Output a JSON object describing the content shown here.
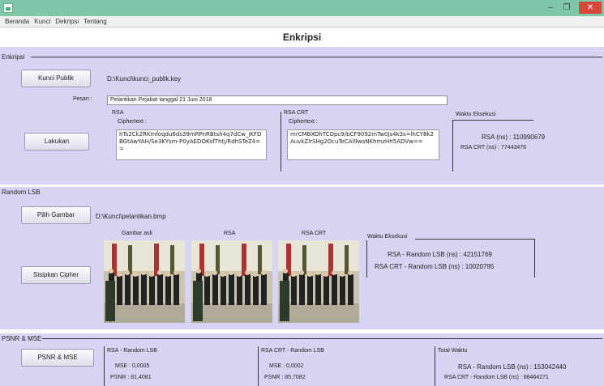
{
  "window": {
    "minimize_glyph": "–",
    "maximize_glyph": "❐",
    "close_glyph": "✕"
  },
  "menu": [
    "Beranda",
    "Kunci",
    "Dekripsi",
    "Tentang"
  ],
  "page_title": "Enkripsi",
  "enkripsi": {
    "legend": "Enkripsi",
    "kunci_publik_button": "Kunci Publik",
    "key_path": "D:\\Kunci\\kunci_publik.key",
    "pesan_label": "Pesan :",
    "pesan_value": "Pelantikan Pejabat tanggal 21 Juni 2018",
    "lakukan_button": "Lakukan",
    "rsa": {
      "title": "RSA",
      "ciphertext_label": "Ciphertext :",
      "ciphertext": "hTs2Ck2RKmfoqdu6ds39mRPnRBtsh4q7dCw_jKFDBGtAwYAH/Se3KYsm-P0yAEDOKsfThtj/RdhSTeZ4=="
    },
    "rsa_crt": {
      "title": "RSA CRT",
      "ciphertext_label": "Ciphertext :",
      "ciphertext": "mrCMBXOhTCOpc9/bCF9092mTw0Js4k3s=lhCY8k2AuvkZlrSHg2OcuTeCAl9wsNKhmzHh5ADVw=="
    },
    "waktu": {
      "title": "Waktu Eksekusi",
      "rsa_line": "RSA (ns) :  110990679",
      "crt_line": "RSA CRT (ns) :  77443476"
    }
  },
  "random_lsb": {
    "legend": "Random LSB",
    "pilih_button": "Pilih Gambar",
    "image_path": "D:\\Kunci\\pelantikan.bmp",
    "sisipkan_button": "Sisipkan Cipher",
    "gambar_asli_label": "Gambar asli",
    "rsa_label": "RSA",
    "rsa_crt_label": "RSA CRT",
    "waktu_title": "Waktu Eksekusi",
    "rsa_line": "RSA - Random LSB (ns) :  42151769",
    "crt_line": "RSA CRT - Random LSB (ns) :  10020795"
  },
  "psnr": {
    "legend": "PSNR & MSE",
    "button": "PSNR & MSE",
    "rsa": {
      "title": "RSA - Random LSB",
      "mse": "MSE : 0,0005",
      "psnr": "PSNR : 81,4081"
    },
    "rsa_crt": {
      "title": "RSA CRT - Random LSB",
      "mse": "MSE : 0,0002",
      "psnr": "PSNR : 85,7082"
    },
    "total": {
      "title": "Total Waktu",
      "rsa_line": "RSA - Random LSB (ns) :  153042440",
      "crt_line": "RSA CRT - Random LSB (ns) :  88464271"
    }
  },
  "colors": {
    "panel_bg": "#d6d4f2",
    "titlebar": "#7ec7a8",
    "close": "#d9473a"
  }
}
